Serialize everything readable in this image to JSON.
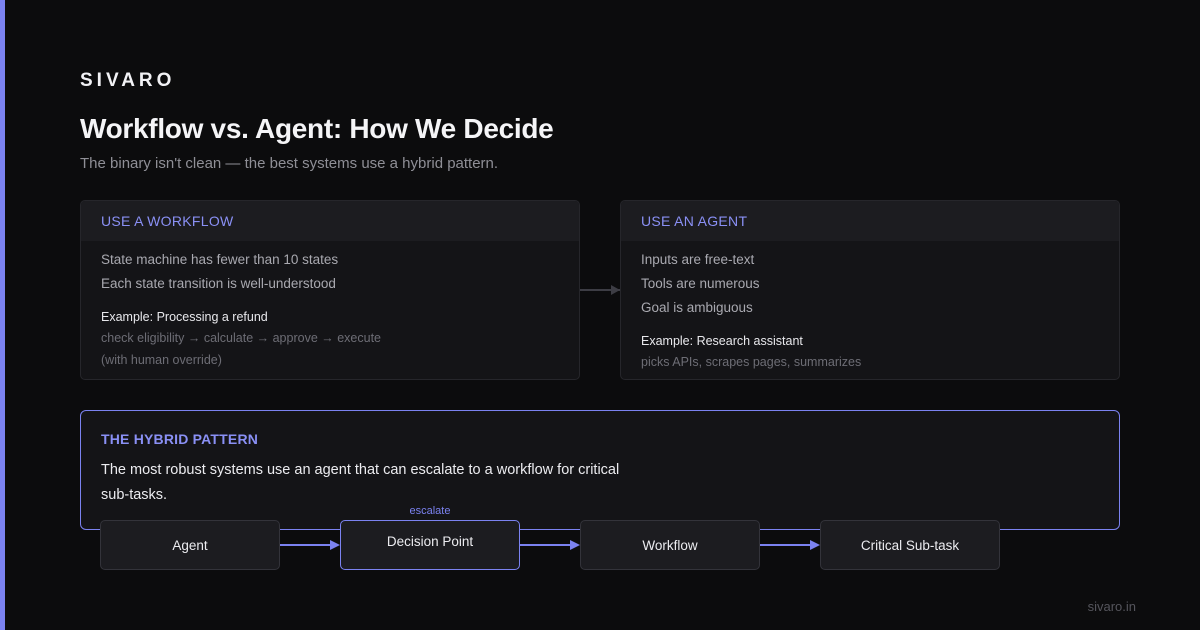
{
  "brand": "SIVARO",
  "title": "Workflow vs. Agent: How We Decide",
  "subtitle": "The binary isn't clean — the best systems use a hybrid pattern.",
  "workflow_card": {
    "heading": "USE A WORKFLOW",
    "items": [
      "State machine has fewer than 10 states",
      "Each state transition is well-understood"
    ],
    "example": "Example: Processing a refund",
    "details": [
      "check eligibility → calculate → approve → execute",
      "(with human override)"
    ]
  },
  "agent_card": {
    "heading": "USE AN AGENT",
    "items": [
      "Inputs are free-text",
      "Tools are numerous",
      "Goal is ambiguous"
    ],
    "example": "Example: Research assistant",
    "details": [
      "picks APIs, scrapes pages, summarizes"
    ]
  },
  "hybrid": {
    "heading": "THE HYBRID PATTERN",
    "description": "The most robust systems use an agent that can escalate to a workflow for critical sub-tasks."
  },
  "flow": {
    "edge_label": "escalate",
    "nodes": [
      "Agent",
      "Decision Point",
      "Workflow",
      "Critical Sub-task"
    ]
  },
  "footer": "sivaro.in",
  "colors": {
    "accent": "#7b82f0",
    "background": "#0c0c0d",
    "card": "#141417"
  }
}
